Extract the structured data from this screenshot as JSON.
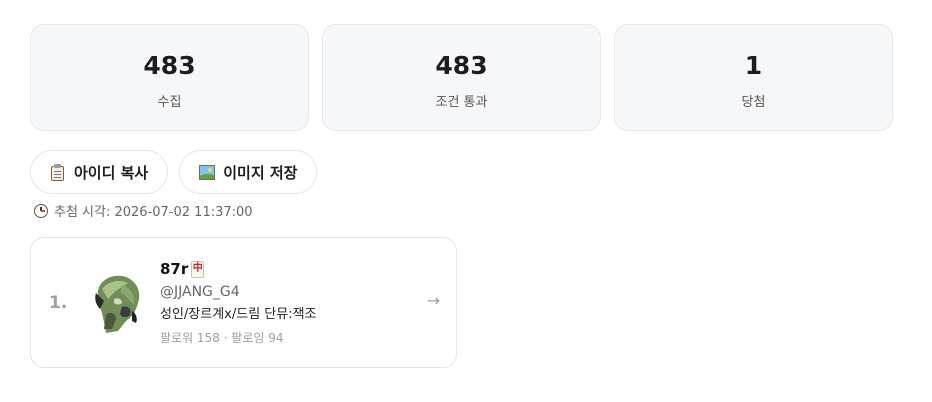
{
  "stats": [
    {
      "value": "483",
      "label": "수집"
    },
    {
      "value": "483",
      "label": "조건 통과"
    },
    {
      "value": "1",
      "label": "당첨"
    }
  ],
  "actions": {
    "copy_ids_label": "아이디 복사",
    "save_image_label": "이미지 저장",
    "copy_icon": "clipboard-icon",
    "save_icon": "framed-picture-icon"
  },
  "draw_time": {
    "icon": "clock-icon",
    "text": "추첨 시각: 2026-07-02 11:37:00"
  },
  "winners": [
    {
      "rank": "1.",
      "display_name": "87r",
      "name_emoji_icon": "mahjong-red-dragon-icon",
      "handle": "@JJANG_G4",
      "bio": "성인/장르계x/드림 단뮤:잭조",
      "follow_text": "팔로워 158 · 팔로잉 94",
      "arrow": "→"
    }
  ]
}
